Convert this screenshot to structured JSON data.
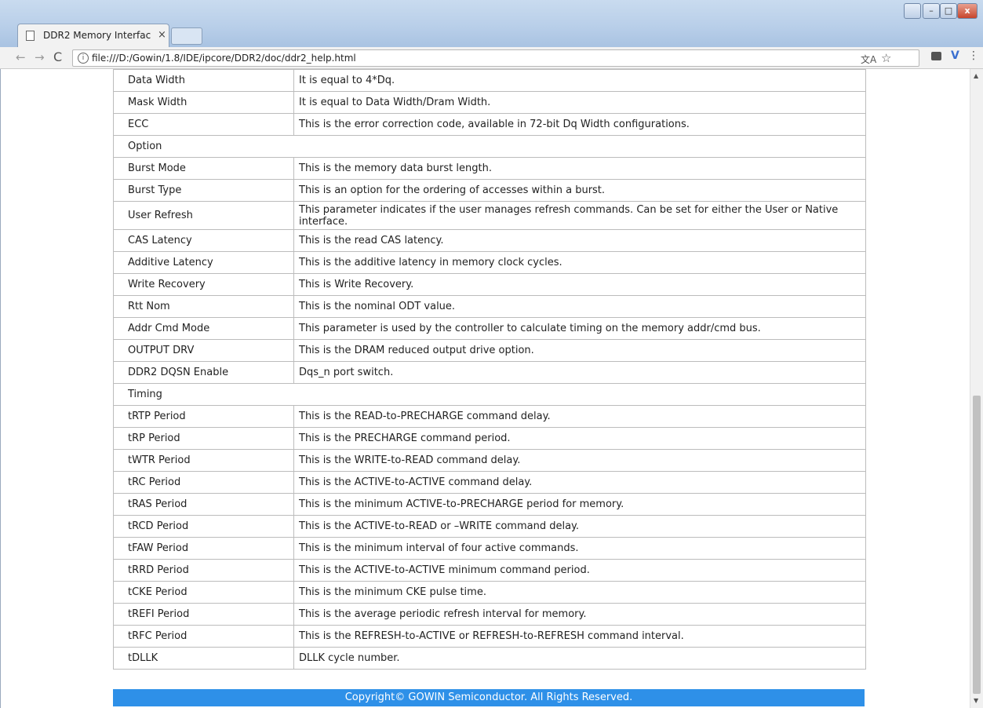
{
  "tab": {
    "title": "DDR2 Memory Interfac",
    "close_label": "×"
  },
  "window_buttons": {
    "minimize": "–",
    "maximize": "□",
    "close": "x"
  },
  "nav": {
    "back": "←",
    "forward": "→",
    "reload": "C"
  },
  "address": {
    "info": "i",
    "url": "file:///D:/Gowin/1.8/IDE/ipcore/DDR2/doc/ddr2_help.html"
  },
  "toolbar_icons": {
    "star": "☆",
    "extension": "V",
    "menu": "⋮",
    "translate": "文A"
  },
  "table": {
    "rows": [
      {
        "name": "Data Width",
        "desc": "It is equal to 4*Dq."
      },
      {
        "name": "Mask Width",
        "desc": "It is equal to Data Width/Dram Width."
      },
      {
        "name": "ECC",
        "desc": "This is the error correction code, available in 72-bit Dq Width configurations."
      },
      {
        "name": "Option",
        "section": true
      },
      {
        "name": "Burst Mode",
        "desc": "This is the memory data burst length."
      },
      {
        "name": "Burst Type",
        "desc": "This is an option for the ordering of accesses within a burst."
      },
      {
        "name": "User Refresh",
        "desc": "This parameter indicates if the user manages refresh commands. Can be set for either the User or Native interface.",
        "tall": true
      },
      {
        "name": "CAS Latency",
        "desc": "This is the read CAS latency."
      },
      {
        "name": "Additive Latency",
        "desc": "This is the additive latency in memory clock cycles."
      },
      {
        "name": "Write Recovery",
        "desc": "This is Write Recovery."
      },
      {
        "name": "Rtt Nom",
        "desc": "This is the nominal ODT value."
      },
      {
        "name": "Addr Cmd Mode",
        "desc": "This parameter is used by the controller to calculate timing on the memory addr/cmd bus."
      },
      {
        "name": "OUTPUT DRV",
        "desc": "This is the DRAM reduced output drive option."
      },
      {
        "name": "DDR2 DQSN Enable",
        "desc": "Dqs_n port switch."
      },
      {
        "name": "Timing",
        "section": true
      },
      {
        "name": "tRTP Period",
        "desc": "This is the READ-to-PRECHARGE command delay."
      },
      {
        "name": "tRP Period",
        "desc": "This is the PRECHARGE command period."
      },
      {
        "name": "tWTR Period",
        "desc": "This is the WRITE-to-READ command delay."
      },
      {
        "name": "tRC Period",
        "desc": "This is the ACTIVE-to-ACTIVE command delay."
      },
      {
        "name": "tRAS Period",
        "desc": "This is the minimum ACTIVE-to-PRECHARGE period for memory."
      },
      {
        "name": "tRCD Period",
        "desc": "This is the ACTIVE-to-READ or –WRITE command delay."
      },
      {
        "name": "tFAW Period",
        "desc": "This is the minimum interval of four active commands."
      },
      {
        "name": "tRRD Period",
        "desc": "This is the ACTIVE-to-ACTIVE minimum command period."
      },
      {
        "name": "tCKE Period",
        "desc": "This is the minimum CKE pulse time."
      },
      {
        "name": "tREFI Period",
        "desc": "This is the average periodic refresh interval for memory."
      },
      {
        "name": "tRFC Period",
        "desc": "This is the REFRESH-to-ACTIVE or REFRESH-to-REFRESH command interval."
      },
      {
        "name": "tDLLK",
        "desc": "DLLK cycle number."
      }
    ]
  },
  "footer": {
    "text": "Copyright© GOWIN Semiconductor. All Rights Reserved."
  },
  "colors": {
    "footer_bg": "#2e90e8",
    "titlebar": "#b9cfe9"
  }
}
